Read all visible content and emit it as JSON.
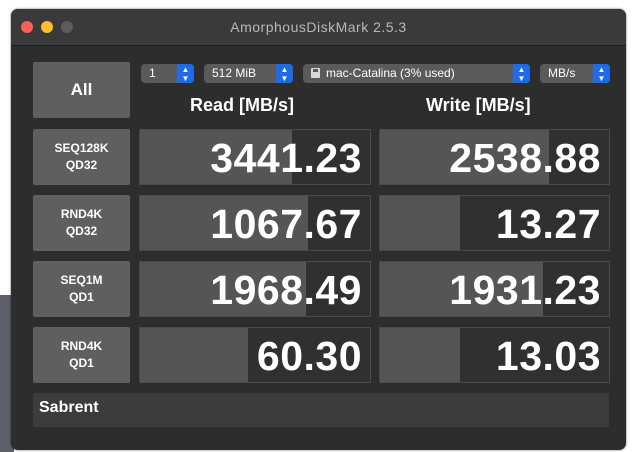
{
  "window": {
    "title": "AmorphousDiskMark 2.5.3"
  },
  "controls": {
    "all_button": "All",
    "count": "1",
    "size": "512 MiB",
    "disk": "mac-Catalina (3% used)",
    "unit": "MB/s",
    "stepper_up": "▲",
    "stepper_down": "▼",
    "disk_icon": "disk-icon"
  },
  "headers": {
    "read": "Read [MB/s]",
    "write": "Write [MB/s]"
  },
  "tests": [
    {
      "line1": "SEQ128K",
      "line2": "QD32",
      "read": "3441.23",
      "write": "2538.88",
      "read_fill": 0.66,
      "write_fill": 0.74
    },
    {
      "line1": "RND4K",
      "line2": "QD32",
      "read": "1067.67",
      "write": "13.27",
      "read_fill": 0.73,
      "write_fill": 0.35
    },
    {
      "line1": "SEQ1M",
      "line2": "QD1",
      "read": "1968.49",
      "write": "1931.23",
      "read_fill": 0.72,
      "write_fill": 0.71
    },
    {
      "line1": "RND4K",
      "line2": "QD1",
      "read": "60.30",
      "write": "13.03",
      "read_fill": 0.47,
      "write_fill": 0.35
    }
  ],
  "comment": "Sabrent",
  "colors": {
    "accent": "#1f6ae6",
    "close": "#ff5f57",
    "minimize": "#febc2e",
    "zoom": "#5c5c5c"
  }
}
